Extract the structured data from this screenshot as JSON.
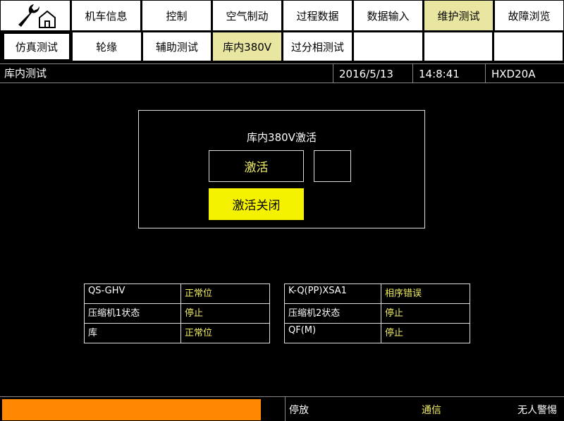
{
  "nav": {
    "tabs": [
      {
        "label": "机车信息",
        "active": false
      },
      {
        "label": "控制",
        "active": false
      },
      {
        "label": "空气制动",
        "active": false
      },
      {
        "label": "过程数据",
        "active": false
      },
      {
        "label": "数据输入",
        "active": false
      },
      {
        "label": "维护测试",
        "active": true
      },
      {
        "label": "故障浏览",
        "active": false
      }
    ]
  },
  "subnav": {
    "tabs": [
      {
        "label": "仿真测试",
        "active": false
      },
      {
        "label": "轮缘",
        "active": false
      },
      {
        "label": "辅助测试",
        "active": false
      },
      {
        "label": "库内380V",
        "active": true
      },
      {
        "label": "过分相测试",
        "active": false
      },
      {
        "label": "",
        "active": false
      },
      {
        "label": "",
        "active": false
      },
      {
        "label": "",
        "active": false
      }
    ]
  },
  "status": {
    "title": "库内测试",
    "date": "2016/5/13",
    "time": "14:8:41",
    "model": "HXD20A"
  },
  "panel": {
    "title": "库内380V激活",
    "activate_label": "激活",
    "deactivate_label": "激活关闭"
  },
  "table_left": {
    "rows": [
      {
        "key": "QS-GHV",
        "value": "正常位"
      },
      {
        "key": "压缩机1状态",
        "value": "停止"
      },
      {
        "key": "库",
        "value": "正常位"
      }
    ]
  },
  "table_right": {
    "rows": [
      {
        "key": "K-Q(PP)XSA1",
        "value": "相序错误"
      },
      {
        "key": "压缩机2状态",
        "value": "停止"
      },
      {
        "key": "QF(M)",
        "value": "停止"
      }
    ]
  },
  "footer": {
    "progress": 1.0,
    "mode": "停放",
    "comm": "通信",
    "alarm": "无人警惕"
  },
  "colors": {
    "accent_yellow": "#f5f200",
    "active_tab": "#e8e6a0",
    "value_text": "#f2ee66",
    "progress": "#ff8800"
  },
  "icons": {
    "home": "wrench-home-icon"
  }
}
